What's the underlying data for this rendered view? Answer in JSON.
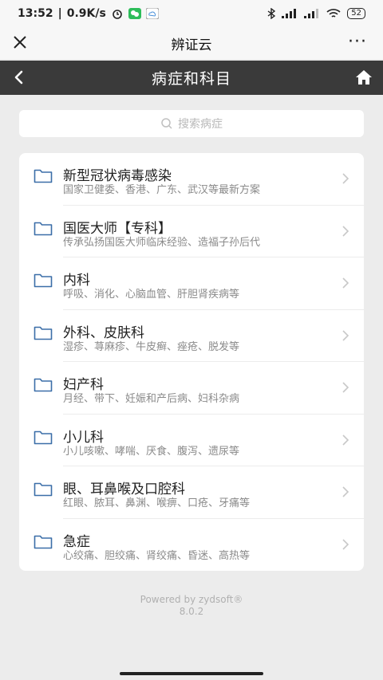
{
  "status_bar": {
    "time": "13:52",
    "speed": "0.9K/s",
    "battery": "52"
  },
  "wechat_bar": {
    "title": "辨证云",
    "more": "···"
  },
  "nav": {
    "title": "病症和科目"
  },
  "search": {
    "placeholder": "搜索病症"
  },
  "categories": [
    {
      "title": "新型冠状病毒感染",
      "subtitle": "国家卫健委、香港、广东、武汉等最新方案"
    },
    {
      "title": "国医大师【专科】",
      "subtitle": "传承弘扬国医大师临床经验、造福子孙后代"
    },
    {
      "title": "内科",
      "subtitle": "呼吸、消化、心脑血管、肝胆肾疾病等"
    },
    {
      "title": "外科、皮肤科",
      "subtitle": "湿疹、荨麻疹、牛皮癣、痤疮、脱发等"
    },
    {
      "title": "妇产科",
      "subtitle": "月经、带下、妊娠和产后病、妇科杂病"
    },
    {
      "title": "小儿科",
      "subtitle": "小儿咳嗽、哮喘、厌食、腹泻、遗尿等"
    },
    {
      "title": "眼、耳鼻喉及口腔科",
      "subtitle": "红眼、脓耳、鼻渊、喉痹、口疮、牙痛等"
    },
    {
      "title": "急症",
      "subtitle": "心绞痛、胆绞痛、肾绞痛、昏迷、高热等"
    }
  ],
  "footer": {
    "powered": "Powered by zydsoft®",
    "version": "8.0.2"
  },
  "colors": {
    "nav_bg": "#3a3a3a",
    "folder": "#3b6ea8"
  }
}
